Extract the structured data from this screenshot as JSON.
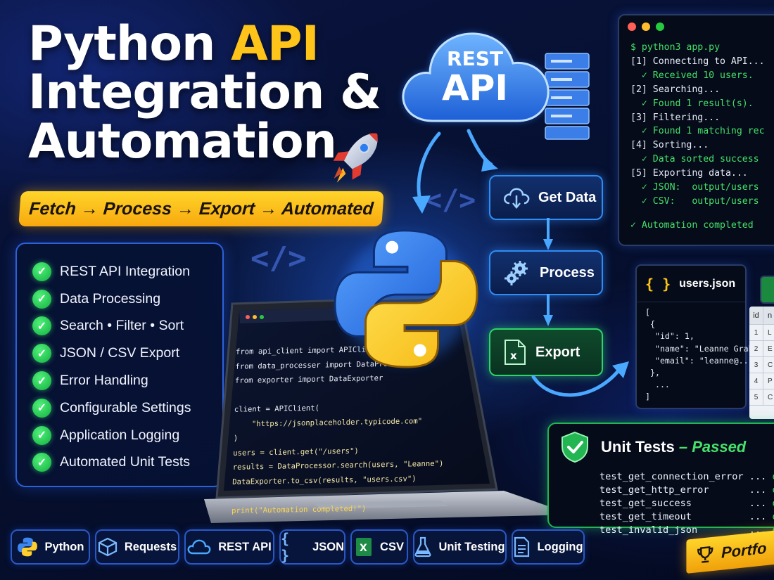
{
  "title": {
    "line1_a": "Python ",
    "line1_b": "API",
    "line2": "Integration &",
    "line3": "Automation"
  },
  "tagline": "Fetch → Process → Export → Automated",
  "features": [
    "REST API Integration",
    "Data Processing",
    "Search • Filter • Sort",
    "JSON / CSV Export",
    "Error Handling",
    "Configurable Settings",
    "Application Logging",
    "Automated Unit Tests"
  ],
  "check_glyph": "✓",
  "cloud": {
    "line1": "REST",
    "line2": "API"
  },
  "flow": {
    "get_data": "Get Data",
    "process": "Process",
    "export": "Export"
  },
  "terminal": {
    "lines": [
      {
        "text": "$ python3 app.py",
        "style": "g"
      },
      {
        "text": "[1] Connecting to API...",
        "style": ""
      },
      {
        "text": "  ✓ Received 10 users.",
        "style": "g"
      },
      {
        "text": "[2] Searching...",
        "style": ""
      },
      {
        "text": "  ✓ Found 1 result(s).",
        "style": "g"
      },
      {
        "text": "[3] Filtering...",
        "style": ""
      },
      {
        "text": "  ✓ Found 1 matching rec",
        "style": "g"
      },
      {
        "text": "[4] Sorting...",
        "style": ""
      },
      {
        "text": "  ✓ Data sorted success",
        "style": "g"
      },
      {
        "text": "[5] Exporting data...",
        "style": ""
      },
      {
        "text": "  ✓ JSON:  output/users",
        "style": "g"
      },
      {
        "text": "  ✓ CSV:   output/users",
        "style": "g"
      },
      {
        "text": "",
        "style": "gap"
      },
      {
        "text": "✓ Automation completed",
        "style": "g"
      }
    ]
  },
  "json_panel": {
    "title": "users.json",
    "brace_icon": "{ }",
    "lines": [
      {
        "p": "[",
        "k": ""
      },
      {
        "p": " {",
        "k": ""
      },
      {
        "p": "  \"id\": 1,",
        "k": ""
      },
      {
        "p": "  \"name\": \"Leanne Graham\",",
        "k": ""
      },
      {
        "p": "  \"email\": \"leanne@...\"",
        "k": ""
      },
      {
        "p": " },",
        "k": ""
      },
      {
        "p": "  ...",
        "k": ""
      },
      {
        "p": "]",
        "k": ""
      }
    ]
  },
  "csv_panel": {
    "header": [
      "id",
      "n"
    ],
    "rows": [
      [
        "1",
        "L"
      ],
      [
        "2",
        "E"
      ],
      [
        "3",
        "C"
      ],
      [
        "4",
        "P"
      ],
      [
        "5",
        "C"
      ]
    ]
  },
  "code": [
    "from api_client import APIClient",
    "from data_processer import DataProces",
    "from exporter import DataExporter",
    "",
    "client = APIClient(",
    "    \"https://jsonplaceholder.typicode.com\"",
    ")",
    "users = client.get(\"/users\")",
    "results = DataProcessor.search(users, \"Leanne\")",
    "DataExporter.to_csv(results, \"users.csv\")",
    "",
    "print(\"Automation completed!\")"
  ],
  "tests": {
    "title": "Unit Tests",
    "dash": " – ",
    "status": "Passed",
    "lines": [
      {
        "name": "test_get_connection_error",
        "dots": " ... ",
        "res": "ok"
      },
      {
        "name": "test_get_http_error",
        "dots": "       ... ",
        "res": "ok"
      },
      {
        "name": "test_get_success",
        "dots": "          ... ",
        "res": "ok"
      },
      {
        "name": "test_get_timeout",
        "dots": "          ... ",
        "res": "ok"
      },
      {
        "name": "test_invalid_json",
        "dots": "         ... ",
        "res": "ok"
      }
    ]
  },
  "badges": [
    "Python",
    "Requests",
    "REST API",
    "JSON",
    "CSV",
    "Unit Testing",
    "Logging"
  ],
  "portfolio": "Portfo",
  "colors": {
    "accent_yellow": "#ffc419",
    "accent_green": "#46e06c",
    "accent_blue": "#2e8df5",
    "bg_dark": "#061030"
  }
}
